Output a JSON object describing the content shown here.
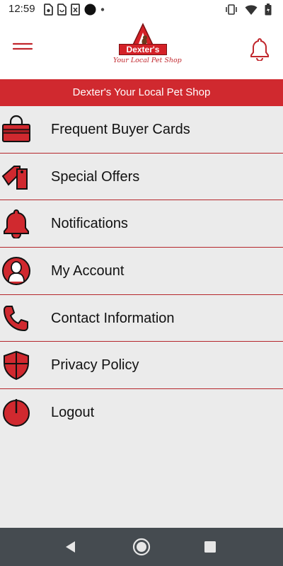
{
  "status_bar": {
    "time": "12:59",
    "left_icons": [
      "sim-card-icon",
      "battery-saver-icon",
      "sd-card-icon",
      "circle-icon",
      "dot-icon"
    ],
    "right_icons": [
      "vibrate-icon",
      "wifi-icon",
      "battery-icon"
    ]
  },
  "header": {
    "logo_name": "Dexter's",
    "logo_tagline": "Your Local Pet Shop",
    "menu_icon": "hamburger-icon",
    "notification_icon": "bell-icon"
  },
  "banner": {
    "title": "Dexter's Your Local Pet Shop"
  },
  "menu": {
    "items": [
      {
        "label": "Frequent Buyer Cards",
        "icon": "shopping-bag-icon"
      },
      {
        "label": "Special Offers",
        "icon": "price-tags-icon"
      },
      {
        "label": "Notifications",
        "icon": "bell-icon"
      },
      {
        "label": "My Account",
        "icon": "user-icon"
      },
      {
        "label": "Contact Information",
        "icon": "phone-icon"
      },
      {
        "label": "Privacy Policy",
        "icon": "shield-icon"
      },
      {
        "label": "Logout",
        "icon": "power-icon"
      }
    ]
  },
  "nav_bar": {
    "buttons": [
      "back-icon",
      "home-icon",
      "recents-icon"
    ]
  },
  "colors": {
    "accent": "#d0292f",
    "list_background": "#ebebeb",
    "nav_bar": "#454b50"
  }
}
